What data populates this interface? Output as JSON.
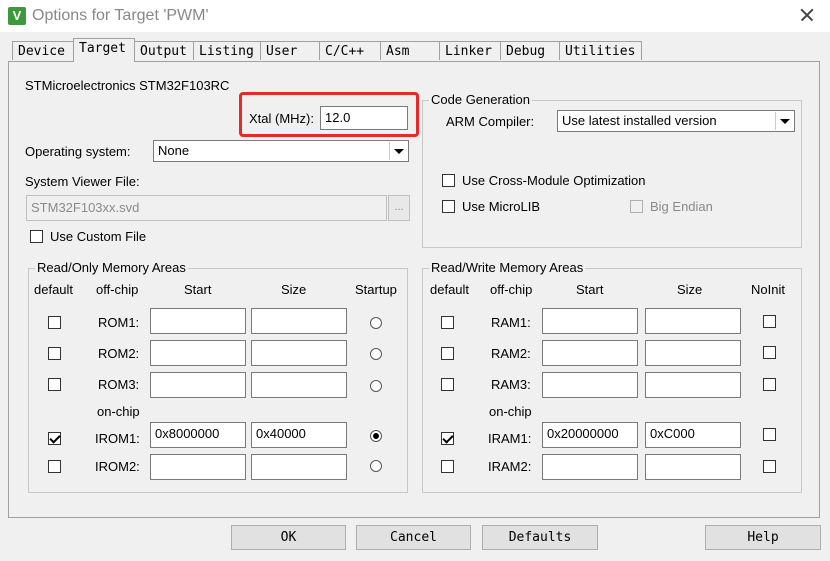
{
  "window": {
    "title": "Options for Target 'PWM'",
    "app_icon": "V"
  },
  "tabs": [
    "Device",
    "Target",
    "Output",
    "Listing",
    "User",
    "C/C++",
    "Asm",
    "Linker",
    "Debug",
    "Utilities"
  ],
  "device": {
    "name": "STMicroelectronics STM32F103RC"
  },
  "xtal": {
    "label": "Xtal (MHz):",
    "value": "12.0"
  },
  "os": {
    "label": "Operating system:",
    "value": "None"
  },
  "svd": {
    "label": "System Viewer File:",
    "value": "STM32F103xx.svd",
    "browse": "..."
  },
  "custom_file": {
    "label": "Use Custom File",
    "checked": false
  },
  "codegen": {
    "title": "Code Generation",
    "compiler_label": "ARM Compiler:",
    "compiler_value": "Use latest installed version",
    "cross_module": "Use Cross-Module Optimization",
    "microlib": "Use MicroLIB",
    "big_endian": "Big Endian"
  },
  "rom": {
    "title": "Read/Only Memory Areas",
    "headers": {
      "default": "default",
      "offchip": "off-chip",
      "start": "Start",
      "size": "Size",
      "startup": "Startup"
    },
    "onchip_label": "on-chip",
    "rows": [
      {
        "label": "ROM1:",
        "start": "",
        "size": ""
      },
      {
        "label": "ROM2:",
        "start": "",
        "size": ""
      },
      {
        "label": "ROM3:",
        "start": "",
        "size": ""
      },
      {
        "label": "IROM1:",
        "start": "0x8000000",
        "size": "0x40000"
      },
      {
        "label": "IROM2:",
        "start": "",
        "size": ""
      }
    ]
  },
  "ram": {
    "title": "Read/Write Memory Areas",
    "headers": {
      "default": "default",
      "offchip": "off-chip",
      "start": "Start",
      "size": "Size",
      "noinit": "NoInit"
    },
    "onchip_label": "on-chip",
    "rows": [
      {
        "label": "RAM1:",
        "start": "",
        "size": ""
      },
      {
        "label": "RAM2:",
        "start": "",
        "size": ""
      },
      {
        "label": "RAM3:",
        "start": "",
        "size": ""
      },
      {
        "label": "IRAM1:",
        "start": "0x20000000",
        "size": "0xC000"
      },
      {
        "label": "IRAM2:",
        "start": "",
        "size": ""
      }
    ]
  },
  "buttons": {
    "ok": "OK",
    "cancel": "Cancel",
    "defaults": "Defaults",
    "help": "Help"
  },
  "colors": {
    "highlight": "#e8292a"
  }
}
